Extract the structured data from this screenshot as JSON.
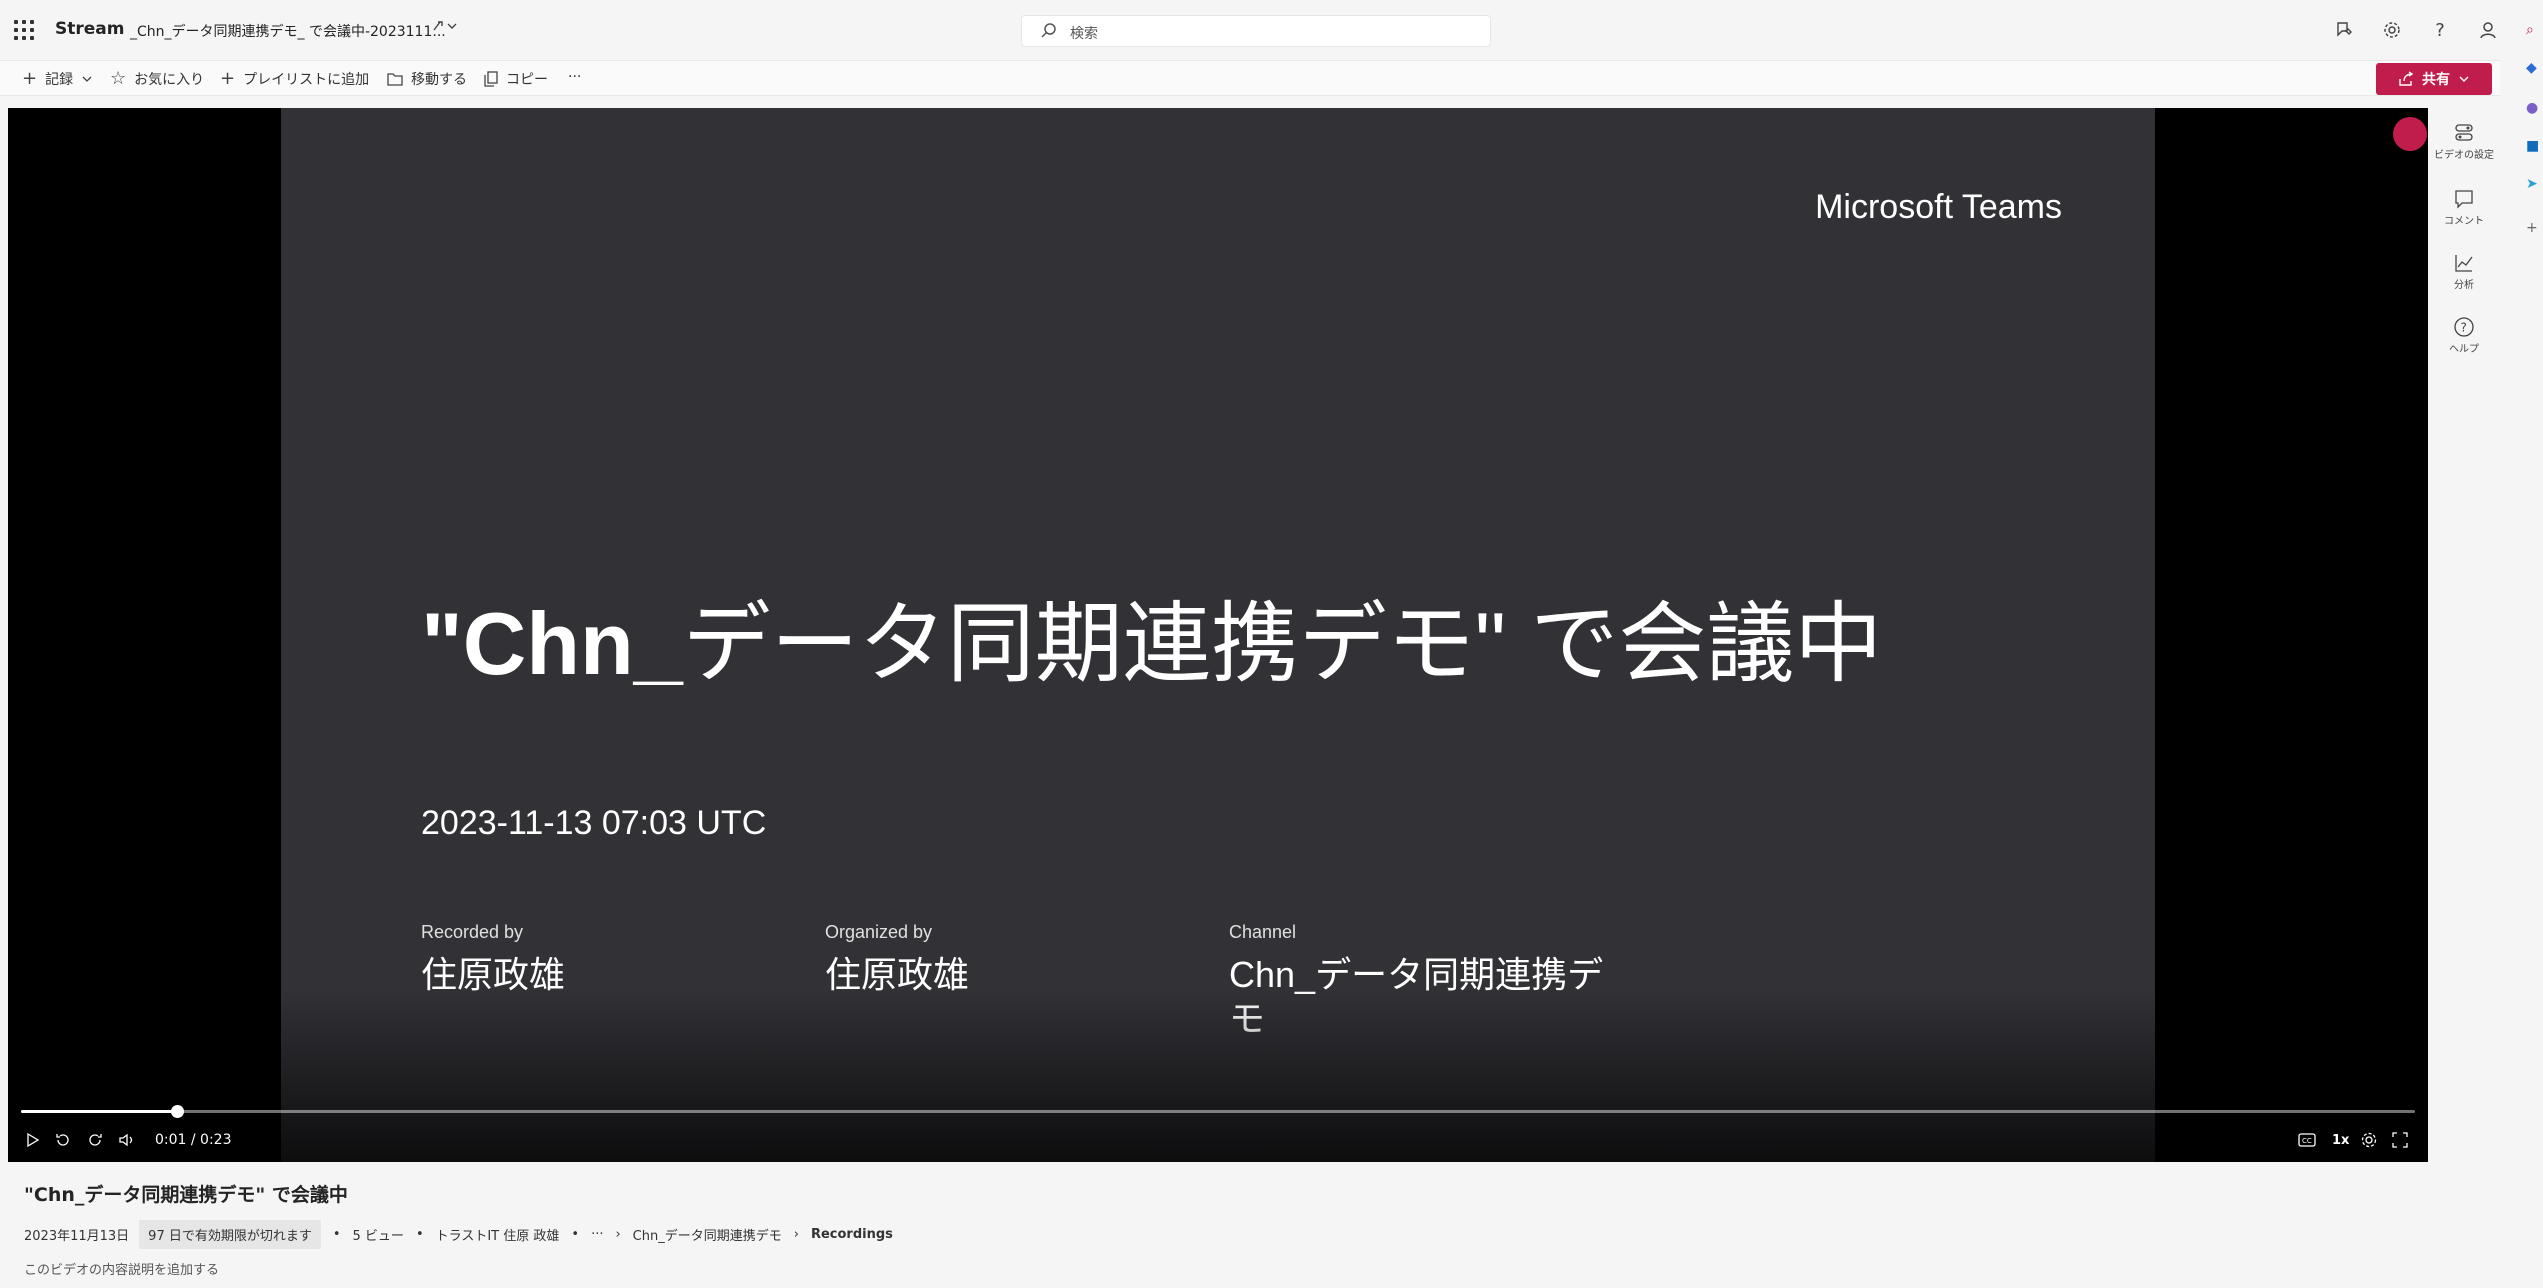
{
  "topbar": {
    "app_name": "Stream",
    "file_title": "_Chn_データ同期連携デモ_ で会議中-2023111...",
    "search_placeholder": "検索",
    "icons": [
      "waffle-icon",
      "feedback-icon",
      "settings-icon",
      "help-icon",
      "account-icon"
    ]
  },
  "commands": {
    "record": "記録",
    "favorite": "お気に入り",
    "add_playlist": "プレイリストに追加",
    "move": "移動する",
    "copy": "コピー",
    "more": "···",
    "share": "共有"
  },
  "slide": {
    "brand": "Microsoft Teams",
    "headline_prefix": "\"Chn_",
    "headline_rest": "データ同期連携デモ\" で会議中",
    "datetime": "2023-11-13 07:03 UTC",
    "recorded_by_label": "Recorded by",
    "recorded_by": "住原政雄",
    "organized_by_label": "Organized by",
    "organized_by": "住原政雄",
    "channel_label": "Channel",
    "channel_line1": "Chn_データ同期連携デ",
    "channel_line2": "モ"
  },
  "player": {
    "current_time": "0:01",
    "duration": "0:23",
    "time_display": "0:01 / 0:23",
    "progress_fraction": 0.065,
    "speed": "1x"
  },
  "rail": {
    "video_settings": "ビデオの設定",
    "comments": "コメント",
    "analytics": "分析",
    "help": "ヘルプ"
  },
  "video_info": {
    "title": "\"Chn_データ同期連携デモ\" で会議中",
    "date": "2023年11月13日",
    "expiry": "97 日で有効期限が切れます",
    "views": "5 ビュー",
    "owner": "トラストIT 住原 政雄",
    "more": "···",
    "breadcrumb_channel": "Chn_データ同期連携デモ",
    "breadcrumb_folder": "Recordings",
    "description_placeholder": "このビデオの内容説明を追加する"
  },
  "colors": {
    "accent": "#c01c4c",
    "slide_bg": "#323136",
    "page_bg": "#f5f5f5"
  }
}
